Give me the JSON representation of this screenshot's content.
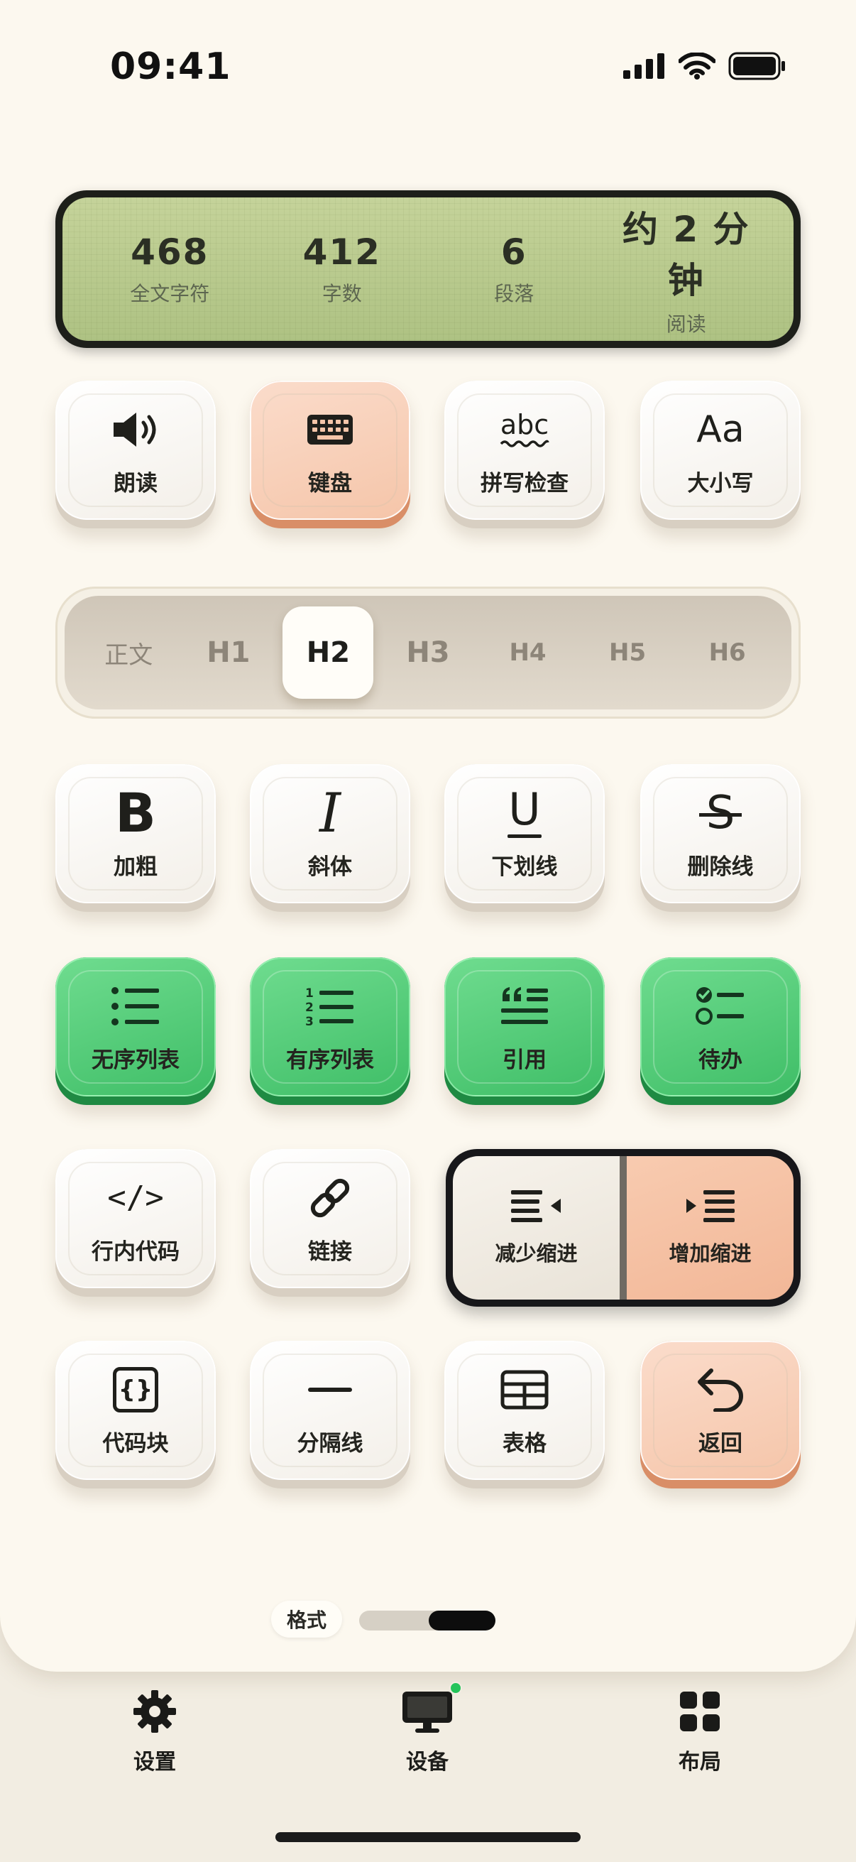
{
  "status_bar": {
    "time": "09:41"
  },
  "stats": [
    {
      "value": "468",
      "label": "全文字符"
    },
    {
      "value": "412",
      "label": "字数"
    },
    {
      "value": "6",
      "label": "段落"
    },
    {
      "value": "约 2 分钟",
      "label": "阅读"
    }
  ],
  "tools": {
    "read_aloud": "朗读",
    "keyboard": "键盘",
    "spell_check": "拼写检查",
    "spell_icon_text": "abc",
    "case": "大小写",
    "case_icon_text": "Aa"
  },
  "headings": {
    "options": [
      "正文",
      "H1",
      "H2",
      "H3",
      "H4",
      "H5",
      "H6"
    ],
    "selected": "H2"
  },
  "format": {
    "bold": "加粗",
    "italic": "斜体",
    "underline": "下划线",
    "strikethrough": "删除线",
    "bold_glyph": "B",
    "italic_glyph": "I",
    "underline_glyph": "U",
    "strike_glyph": "S"
  },
  "lists": {
    "unordered": "无序列表",
    "ordered": "有序列表",
    "quote": "引用",
    "todo": "待办"
  },
  "insert": {
    "inline_code": "行内代码",
    "inline_code_glyph": "</>",
    "link": "链接",
    "outdent": "减少缩进",
    "indent": "增加缩进",
    "code_block": "代码块",
    "code_block_glyph": "{}",
    "divider": "分隔线",
    "table": "表格",
    "back": "返回"
  },
  "pager": {
    "label": "格式",
    "page": 2,
    "pages": 2
  },
  "bottom_nav": {
    "settings": "设置",
    "devices": "设备",
    "layout": "布局"
  },
  "colors": {
    "accent_green": "#3fbe67",
    "accent_peach": "#f5c5a9",
    "lcd": "#b9c98e",
    "status_dot": "#25c45b"
  }
}
